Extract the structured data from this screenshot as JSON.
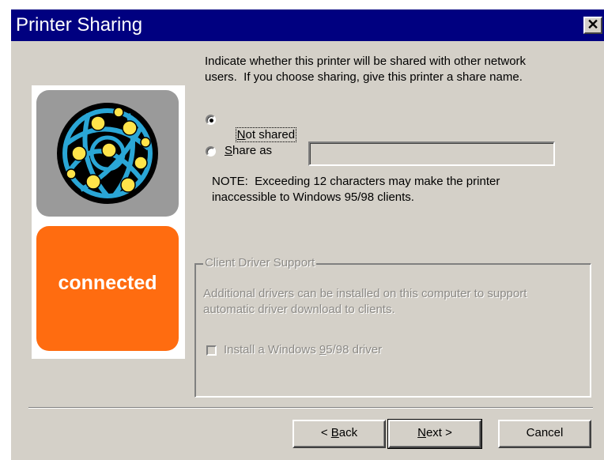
{
  "window": {
    "title": "Printer Sharing",
    "close_glyph": "✕",
    "close_icon": "close-icon"
  },
  "image": {
    "caption": "connected",
    "logo_icon": "network-globe-icon",
    "tile_colors": [
      "#9a9a9a",
      "#ff6c10"
    ]
  },
  "intro": {
    "line1": "Indicate whether this printer will be shared with other network",
    "line2": "users.  If you choose sharing, give this printer a share name."
  },
  "sharing": {
    "not_shared_mn": "N",
    "not_shared_rest": "ot shared",
    "not_shared_selected": true,
    "share_as_mn": "S",
    "share_as_rest": "hare as",
    "share_name_value": "",
    "note_line1": "NOTE:  Exceeding 12 characters may make the printer",
    "note_line2": "inaccessible to Windows 95/98 clients."
  },
  "client_driver": {
    "legend": "Client Driver Support",
    "desc_line1": "Additional drivers can be installed on this computer to support",
    "desc_line2": "automatic driver download to clients.",
    "install_pre": "Install a Windows ",
    "install_mn": "9",
    "install_post": "5/98 driver",
    "install_checked": false
  },
  "buttons": {
    "back_prefix": "< ",
    "back_mn": "B",
    "back_rest": "ack",
    "next_mn": "N",
    "next_rest": "ext >",
    "cancel": "Cancel"
  },
  "colors": {
    "titlebar": "#000080",
    "dialog_face": "#d4d0c8",
    "accent_orange": "#ff6c10"
  }
}
